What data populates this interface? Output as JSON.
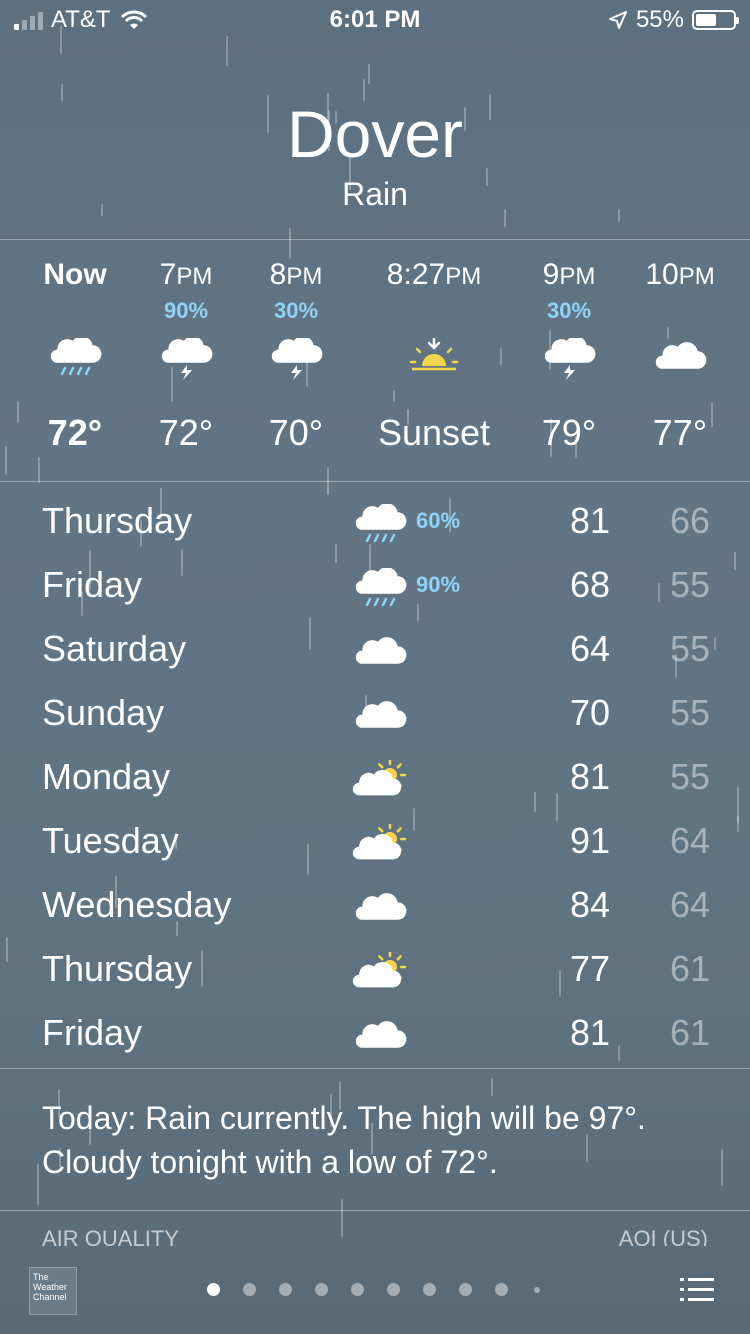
{
  "status_bar": {
    "carrier": "AT&T",
    "time": "6:01 PM",
    "battery": "55%",
    "battery_level": 0.55
  },
  "location": {
    "city": "Dover",
    "condition": "Rain"
  },
  "hourly": [
    {
      "time": "Now",
      "suffix": "",
      "precip": "",
      "icon": "rain-cloud-icon",
      "temp": "72°"
    },
    {
      "time": "7",
      "suffix": "PM",
      "precip": "90%",
      "icon": "thunderstorm-icon",
      "temp": "72°"
    },
    {
      "time": "8",
      "suffix": "PM",
      "precip": "30%",
      "icon": "thunderstorm-icon",
      "temp": "70°"
    },
    {
      "time": "8:27",
      "suffix": "PM",
      "precip": "",
      "icon": "sunset-icon",
      "temp": "Sunset"
    },
    {
      "time": "9",
      "suffix": "PM",
      "precip": "30%",
      "icon": "thunderstorm-icon",
      "temp": "79°"
    },
    {
      "time": "10",
      "suffix": "PM",
      "precip": "",
      "icon": "cloud-icon",
      "temp": "77°"
    }
  ],
  "daily": [
    {
      "day": "Thursday",
      "icon": "rain-cloud-icon",
      "precip": "60%",
      "high": "81",
      "low": "66"
    },
    {
      "day": "Friday",
      "icon": "rain-cloud-icon",
      "precip": "90%",
      "high": "68",
      "low": "55"
    },
    {
      "day": "Saturday",
      "icon": "cloud-icon",
      "precip": "",
      "high": "64",
      "low": "55"
    },
    {
      "day": "Sunday",
      "icon": "cloud-icon",
      "precip": "",
      "high": "70",
      "low": "55"
    },
    {
      "day": "Monday",
      "icon": "partly-sunny-icon",
      "precip": "",
      "high": "81",
      "low": "55"
    },
    {
      "day": "Tuesday",
      "icon": "partly-sunny-icon",
      "precip": "",
      "high": "91",
      "low": "64"
    },
    {
      "day": "Wednesday",
      "icon": "cloud-icon",
      "precip": "",
      "high": "84",
      "low": "64"
    },
    {
      "day": "Thursday",
      "icon": "partly-sunny-icon",
      "precip": "",
      "high": "77",
      "low": "61"
    },
    {
      "day": "Friday",
      "icon": "cloud-icon",
      "precip": "",
      "high": "81",
      "low": "61"
    }
  ],
  "summary": {
    "line1": "Today: Rain currently. The high will be 97°.",
    "line2": "Cloudy tonight with a low of 72°."
  },
  "air_quality": {
    "label": "AIR QUALITY",
    "unit": "AQI (US)"
  },
  "footer": {
    "logo_lines": [
      "The",
      "Weather",
      "Channel"
    ],
    "page_count": 10,
    "active_page": 0
  },
  "colors": {
    "precip": "#8fd3f7",
    "sun": "#f6d64a"
  }
}
